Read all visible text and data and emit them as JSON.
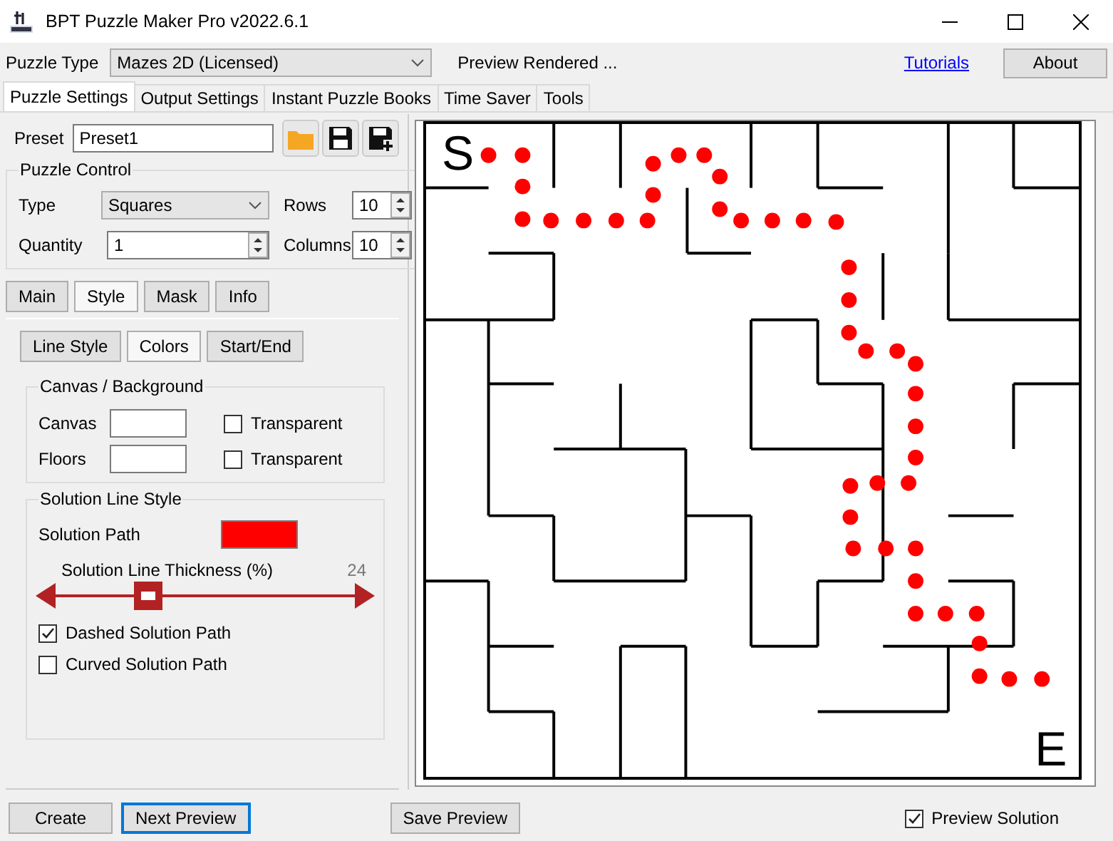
{
  "window": {
    "title": "BPT Puzzle Maker Pro v2022.6.1"
  },
  "toolbar": {
    "puzzle_type_label": "Puzzle Type",
    "puzzle_type_value": "Mazes 2D (Licensed)",
    "status": "Preview Rendered ...",
    "tutorials_link": "Tutorials",
    "about_button": "About"
  },
  "tabs": [
    {
      "label": "Puzzle Settings",
      "selected": true
    },
    {
      "label": "Output Settings",
      "selected": false
    },
    {
      "label": "Instant Puzzle Books",
      "selected": false
    },
    {
      "label": "Time Saver",
      "selected": false
    },
    {
      "label": "Tools",
      "selected": false
    }
  ],
  "preset": {
    "label": "Preset",
    "value": "Preset1"
  },
  "puzzle_control": {
    "title": "Puzzle Control",
    "type_label": "Type",
    "type_value": "Squares",
    "rows_label": "Rows",
    "rows_value": "10",
    "quantity_label": "Quantity",
    "quantity_value": "1",
    "columns_label": "Columns",
    "columns_value": "10"
  },
  "section_tabs": [
    {
      "label": "Main",
      "selected": false
    },
    {
      "label": "Style",
      "selected": true
    },
    {
      "label": "Mask",
      "selected": false
    },
    {
      "label": "Info",
      "selected": false
    }
  ],
  "style_tabs": [
    {
      "label": "Line Style",
      "selected": false
    },
    {
      "label": "Colors",
      "selected": true
    },
    {
      "label": "Start/End",
      "selected": false
    }
  ],
  "canvas_background": {
    "title": "Canvas / Background",
    "rows": [
      {
        "label": "Canvas",
        "checkbox_label": "Transparent",
        "checked": false
      },
      {
        "label": "Floors",
        "checkbox_label": "Transparent",
        "checked": false
      }
    ]
  },
  "solution_line_style": {
    "title": "Solution Line Style",
    "path_label": "Solution Path",
    "path_swatch": {
      "color": "#ff0000"
    },
    "thickness_label": "Solution Line Thickness (%)",
    "thickness_value": "24",
    "level": 0.31,
    "options": [
      {
        "label": "Dashed Solution Path",
        "checked": true
      },
      {
        "label": "Curved Solution Path",
        "checked": false
      }
    ]
  },
  "preview": {
    "start_label": "S",
    "end_label": "E"
  },
  "bottom_buttons": [
    {
      "label": "Create",
      "focused": false
    },
    {
      "label": "Next Preview",
      "focused": true
    },
    {
      "label": "Save Preview",
      "focused": false
    }
  ],
  "preview_solution": {
    "label": "Preview Solution",
    "checked": true
  }
}
